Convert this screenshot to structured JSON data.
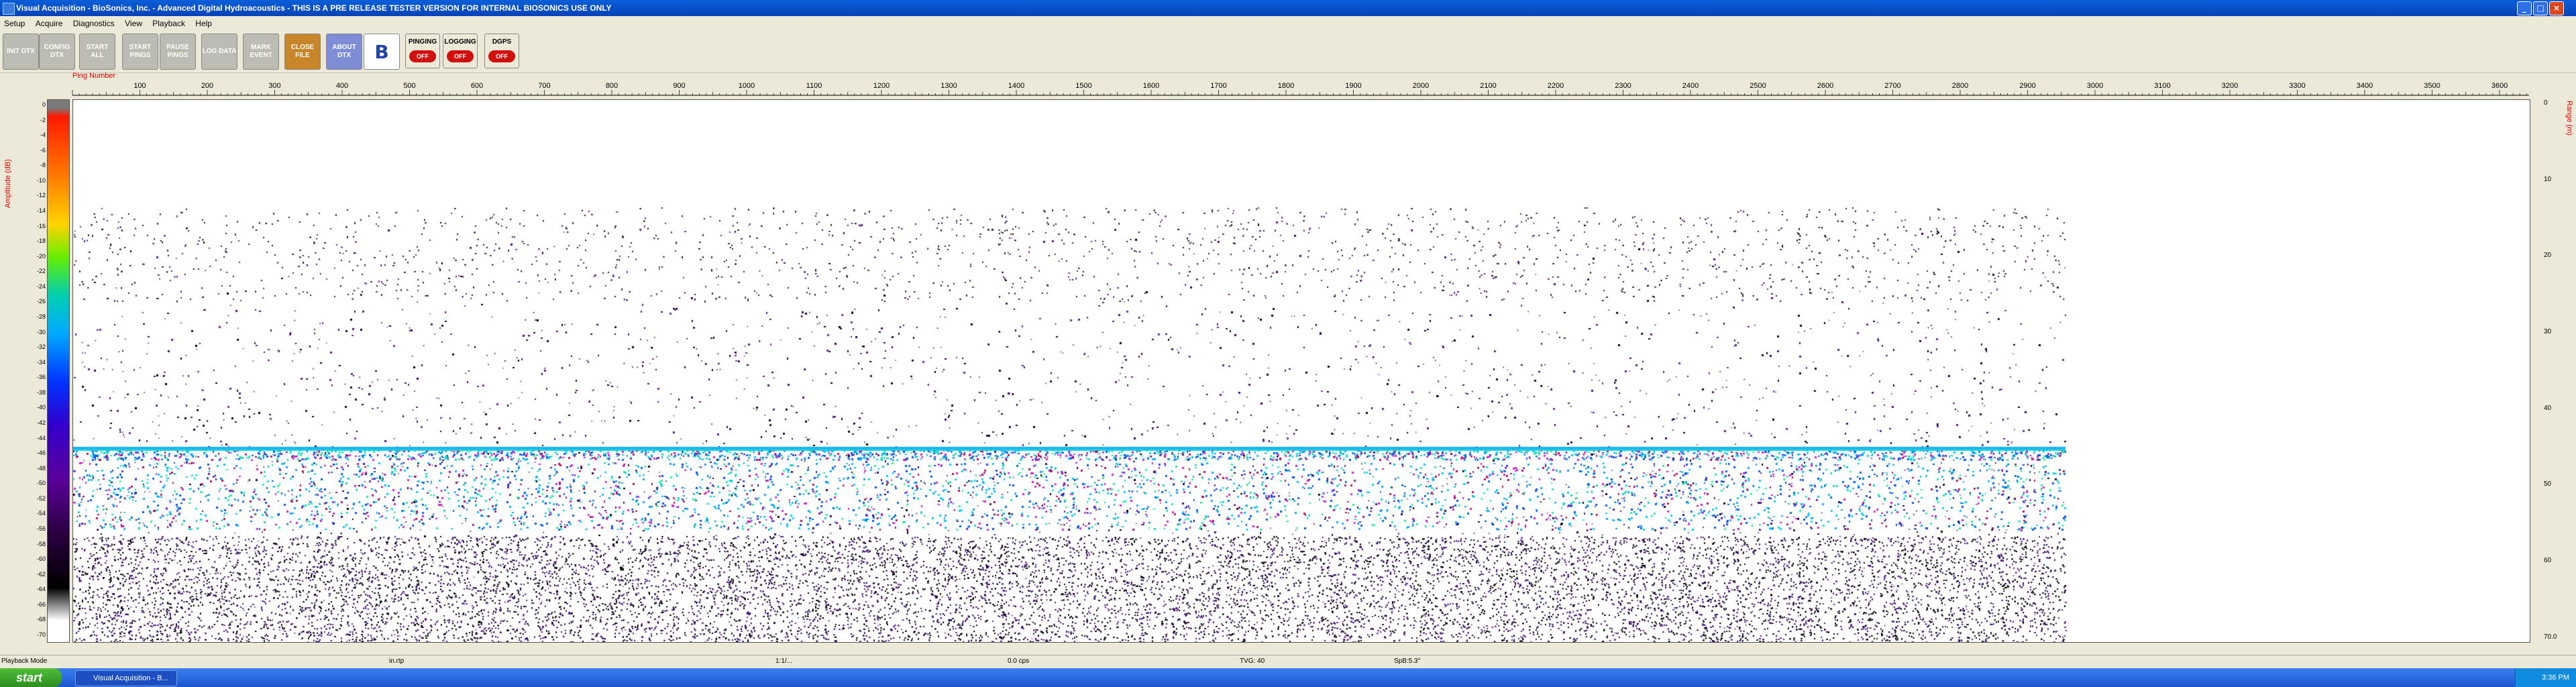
{
  "window": {
    "title": "Visual Acquisition  -  BioSonics, Inc.  -  Advanced Digital Hydroacoustics  -  THIS IS A PRE RELEASE TESTER VERSION FOR INTERNAL BIOSONICS USE ONLY",
    "minimize": "_",
    "maximize": "□",
    "close": "×"
  },
  "menu": [
    "Setup",
    "Acquire",
    "Diagnostics",
    "View",
    "Playback",
    "Help"
  ],
  "toolbar": {
    "buttons": [
      {
        "label": "INIT DTX",
        "style": "gray"
      },
      {
        "label": "CONFIG DTX",
        "style": "gray"
      },
      {
        "label": "START ALL",
        "style": "gray"
      },
      {
        "label": "START PINGS",
        "style": "gray"
      },
      {
        "label": "PAUSE PINGS",
        "style": "gray"
      },
      {
        "label": "LOG DATA",
        "style": "gray"
      },
      {
        "label": "MARK EVENT",
        "style": "gray"
      },
      {
        "label": "CLOSE FILE",
        "style": "orange"
      },
      {
        "label": "ABOUT DTX",
        "style": "blue"
      }
    ],
    "logo": "B",
    "indicators": [
      {
        "label": "PINGING",
        "state": "OFF"
      },
      {
        "label": "LOGGING",
        "state": "OFF"
      },
      {
        "label": "DGPS",
        "state": "OFF"
      }
    ]
  },
  "ping_axis": {
    "label": "Ping Number",
    "ticks": [
      "100",
      "200",
      "300",
      "400",
      "500",
      "600",
      "700",
      "800",
      "900",
      "1000",
      "1100",
      "1200",
      "1300",
      "1400",
      "1500",
      "1600",
      "1700",
      "1800",
      "1900",
      "2000",
      "2100",
      "2200",
      "2300",
      "2400",
      "2500",
      "2600",
      "2700",
      "2800",
      "2900",
      "3000",
      "3100",
      "3200",
      "3300",
      "3400",
      "3500",
      "3600"
    ]
  },
  "amplitude_scale": {
    "label": "Amplitude (dB)",
    "ticks": [
      "0",
      "-2",
      "-4",
      "-6",
      "-8",
      "-10",
      "-12",
      "-14",
      "-16",
      "-18",
      "-20",
      "-22",
      "-24",
      "-26",
      "-28",
      "-30",
      "-32",
      "-34",
      "-36",
      "-38",
      "-40",
      "-42",
      "-44",
      "-46",
      "-48",
      "-50",
      "-52",
      "-54",
      "-56",
      "-58",
      "-60",
      "-62",
      "-64",
      "-66",
      "-68",
      "-70"
    ]
  },
  "range_axis": {
    "label": "Range (m)",
    "ticks": [
      "0",
      "10",
      "20",
      "30",
      "40",
      "50",
      "60",
      "70.0"
    ]
  },
  "status": {
    "mode": "Playback Mode",
    "file": "in.rtp",
    "time": "1:1/...",
    "rate": "0.0 cps",
    "tvg": "TVG: 40",
    "sp": "SpB:5.3°"
  },
  "taskbar": {
    "start": "start",
    "task": "Visual Acquisition - B...",
    "clock": "3:36 PM"
  },
  "colors": {
    "titlebar": "#0a5fd8",
    "red_accent": "#dd0000"
  }
}
